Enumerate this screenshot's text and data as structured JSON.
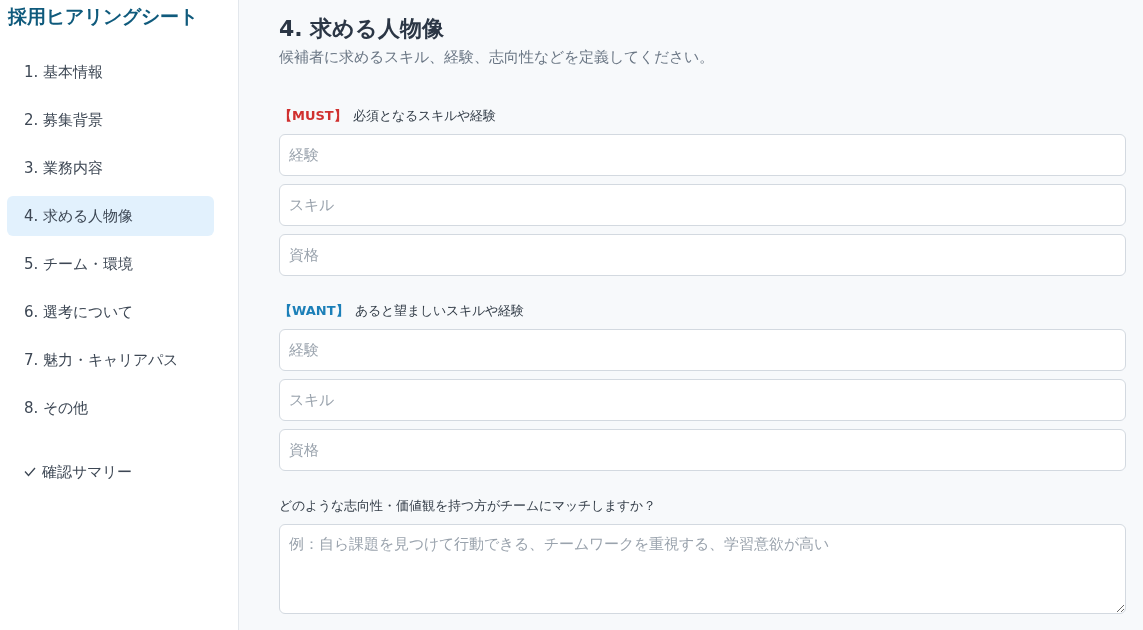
{
  "sidebar": {
    "title": "採用ヒアリングシート",
    "items": [
      {
        "label": "1. 基本情報",
        "selected": false
      },
      {
        "label": "2. 募集背景",
        "selected": false
      },
      {
        "label": "3. 業務内容",
        "selected": false
      },
      {
        "label": "4. 求める人物像",
        "selected": true
      },
      {
        "label": "5. チーム・環境",
        "selected": false
      },
      {
        "label": "6. 選考について",
        "selected": false
      },
      {
        "label": "7. 魅力・キャリアパス",
        "selected": false
      },
      {
        "label": "8. その他",
        "selected": false
      }
    ],
    "summary": {
      "label": "確認サマリー",
      "selected": false
    }
  },
  "main": {
    "title": "4. 求める人物像",
    "description": "候補者に求めるスキル、経験、志向性などを定義してください。",
    "groups": [
      {
        "kind": "must",
        "tag": "【MUST】",
        "label": "必須となるスキルや経験",
        "fields": [
          {
            "placeholder": "経験"
          },
          {
            "placeholder": "スキル"
          },
          {
            "placeholder": "資格"
          }
        ]
      },
      {
        "kind": "want",
        "tag": "【WANT】",
        "label": "あると望ましいスキルや経験",
        "fields": [
          {
            "placeholder": "経験"
          },
          {
            "placeholder": "スキル"
          },
          {
            "placeholder": "資格"
          }
        ]
      }
    ],
    "question": {
      "label": "どのような志向性・価値観を持つ方がチームにマッチしますか？",
      "placeholder": "例：自ら課題を見つけて行動できる、チームワークを重視する、学習意欲が高い"
    }
  }
}
